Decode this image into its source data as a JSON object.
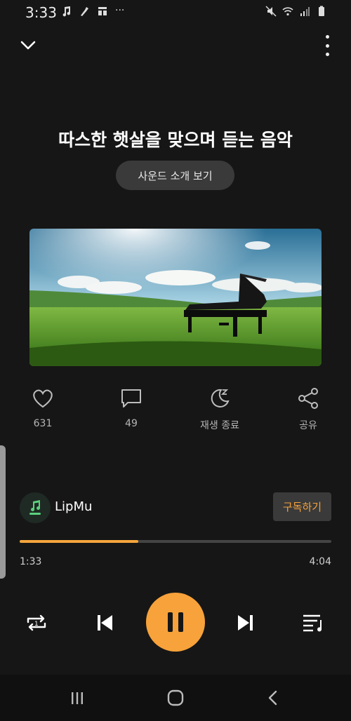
{
  "status_bar": {
    "time": "3:33",
    "more": "···",
    "icons_left": [
      "music-note-icon",
      "tool-icon",
      "grid-icon"
    ],
    "icons_right": [
      "mute-icon",
      "wifi-icon",
      "signal-icon",
      "battery-icon"
    ]
  },
  "header": {
    "title": "따스한 햇살을 맞으며 듣는 음악",
    "sound_intro_label": "사운드 소개 보기"
  },
  "actions": [
    {
      "icon": "heart-icon",
      "label": "631"
    },
    {
      "icon": "comment-icon",
      "label": "49"
    },
    {
      "icon": "sleep-timer-icon",
      "label": "재생 종료"
    },
    {
      "icon": "share-icon",
      "label": "공유"
    }
  ],
  "channel": {
    "name": "LipMu",
    "subscribe_label": "구독하기"
  },
  "progress": {
    "current": "1:33",
    "total": "4:04",
    "fraction": 0.38
  },
  "colors": {
    "accent": "#f7a23a",
    "background": "#161616"
  }
}
